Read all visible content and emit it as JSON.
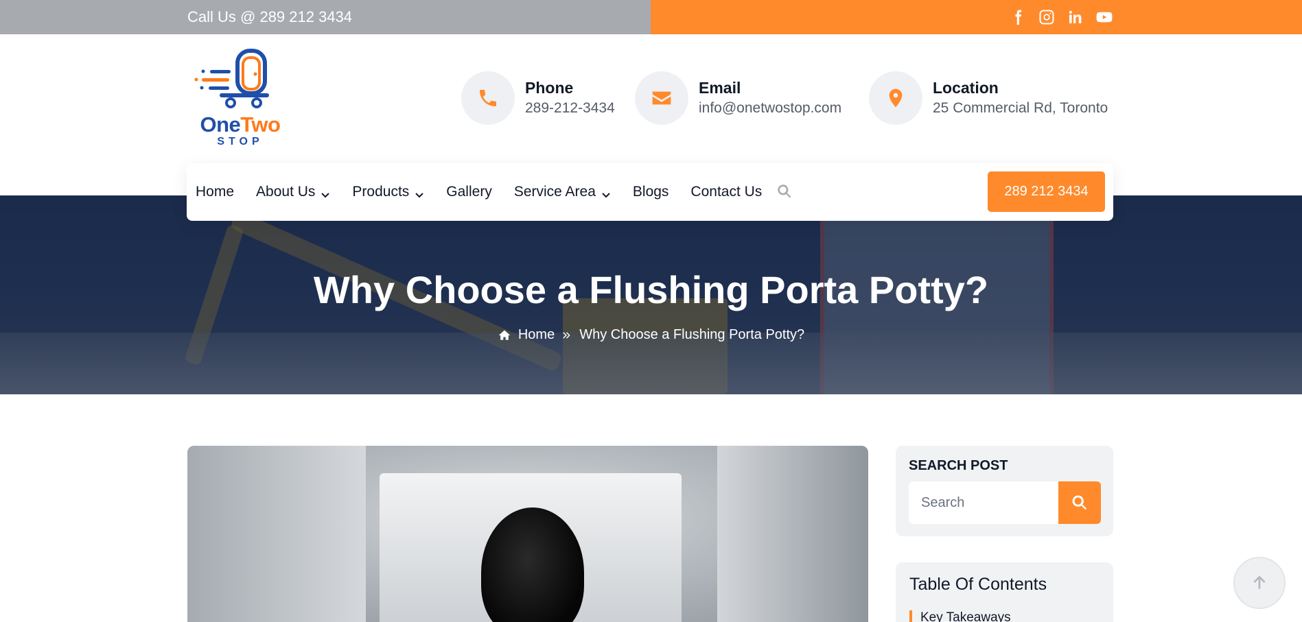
{
  "topbar": {
    "call_text": "Call Us @ 289 212 3434",
    "social": [
      "facebook-icon",
      "instagram-icon",
      "linkedin-icon",
      "youtube-icon"
    ],
    "colors": {
      "left_bg": "#a7abb0",
      "right_bg": "#ff8a2b"
    }
  },
  "logo": {
    "one": "One",
    "two": "Two",
    "stop": "STOP"
  },
  "contacts": [
    {
      "icon": "phone-icon",
      "label": "Phone",
      "value": "289-212-3434"
    },
    {
      "icon": "envelope-icon",
      "label": "Email",
      "value": "info@onetwostop.com"
    },
    {
      "icon": "location-pin-icon",
      "label": "Location",
      "value": "25 Commercial Rd, Toronto"
    }
  ],
  "nav": {
    "items": [
      "Home",
      "About Us",
      "Products",
      "Gallery",
      "Service Area",
      "Blogs",
      "Contact Us"
    ],
    "dropdowns": [
      "About Us",
      "Products",
      "Service Area"
    ],
    "cta": "289 212 3434"
  },
  "hero": {
    "title": "Why Choose a Flushing Porta Potty?",
    "breadcrumb_home": "Home",
    "breadcrumb_current": "Why Choose a Flushing Porta Potty?"
  },
  "sidebar": {
    "search_title": "SEARCH POST",
    "search_placeholder": "Search",
    "toc_title": "Table Of Contents",
    "toc_first": "Key Takeaways"
  },
  "accent_color": "#ff8a2b"
}
